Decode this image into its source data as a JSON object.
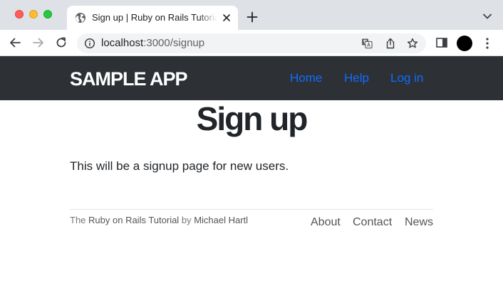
{
  "browser": {
    "tab": {
      "title": "Sign up | Ruby on Rails Tutorial Sample App"
    },
    "address_bar": {
      "host": "localhost",
      "path": ":3000/signup"
    }
  },
  "site": {
    "logo": "SAMPLE APP",
    "nav": [
      {
        "label": "Home"
      },
      {
        "label": "Help"
      },
      {
        "label": "Log in"
      }
    ]
  },
  "main": {
    "title": "Sign up",
    "intro": "This will be a signup page for new users."
  },
  "footer": {
    "credit_prefix": "The",
    "credit_link": "Ruby on Rails Tutorial",
    "credit_by": "by",
    "author": "Michael Hartl",
    "links": [
      {
        "label": "About"
      },
      {
        "label": "Contact"
      },
      {
        "label": "News"
      }
    ]
  },
  "colors": {
    "header_bg": "#2d3136",
    "nav_link": "#0d6efd",
    "text": "#212529",
    "footer_text": "#777777"
  },
  "icons": [
    "globe-icon",
    "close-icon",
    "plus-icon",
    "chevron-down-icon",
    "back-arrow-icon",
    "forward-arrow-icon",
    "reload-icon",
    "info-icon",
    "translate-icon",
    "share-icon",
    "star-icon",
    "side-panel-icon",
    "kebab-menu-icon"
  ]
}
